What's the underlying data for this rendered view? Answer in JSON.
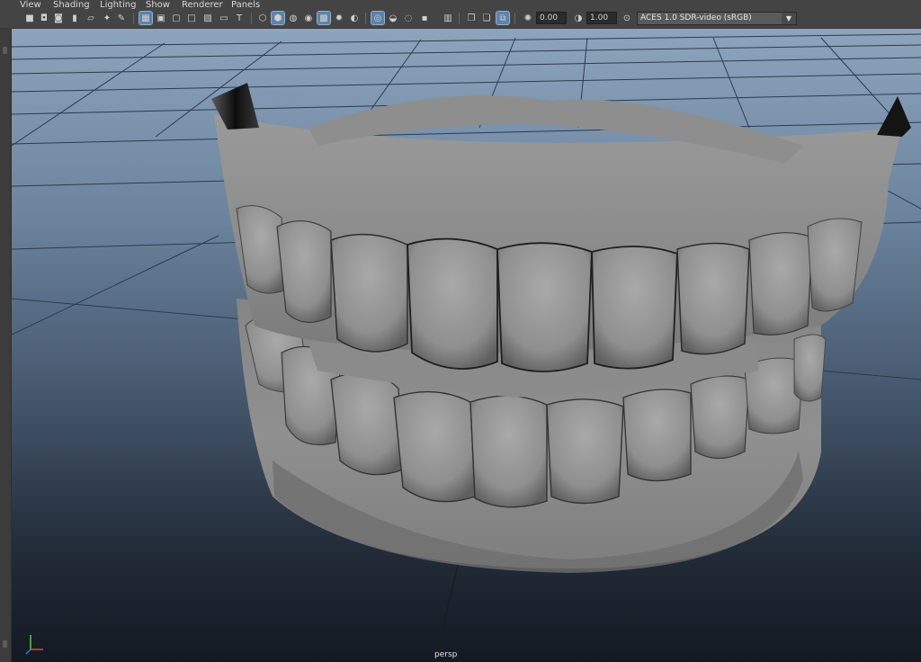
{
  "menu": {
    "items": [
      {
        "id": "view",
        "label": "View"
      },
      {
        "id": "shading",
        "label": "Shading"
      },
      {
        "id": "lighting",
        "label": "Lighting"
      },
      {
        "id": "show",
        "label": "Show"
      },
      {
        "id": "renderer",
        "label": "Renderer"
      },
      {
        "id": "panels",
        "label": "Panels"
      }
    ]
  },
  "toolbar": {
    "exposure_value": "0.00",
    "gamma_value": "1.00",
    "color_space": "ACES 1.0 SDR-video (sRGB)",
    "icons": [
      "camera-select-icon",
      "camera-attributes-icon",
      "bookmark-icon",
      "image-plane-icon",
      "2d-pan-zoom-icon",
      "grease-pencil-icon",
      "grid-icon",
      "film-gate-icon",
      "resolution-gate-icon",
      "gate-mask-icon",
      "field-chart-icon",
      "safe-action-icon",
      "safe-title-icon",
      "wireframe-icon",
      "smooth-shade-icon",
      "wireframe-on-shaded-icon",
      "xray-icon",
      "default-lighting-icon",
      "textured-icon",
      "shadows-icon",
      "ambient-occlusion-icon",
      "motion-blur-icon",
      "anti-aliasing-icon",
      "depth-of-field-icon",
      "isolate-select-icon",
      "xray-joints-icon",
      "xray-active-icon",
      "camera-layers-icon"
    ]
  },
  "viewport": {
    "camera_label": "persp"
  },
  "colors": {
    "ui_bg": "#444444",
    "active_icon": "#5e82a8",
    "grid_line": "#2e3b4c"
  }
}
